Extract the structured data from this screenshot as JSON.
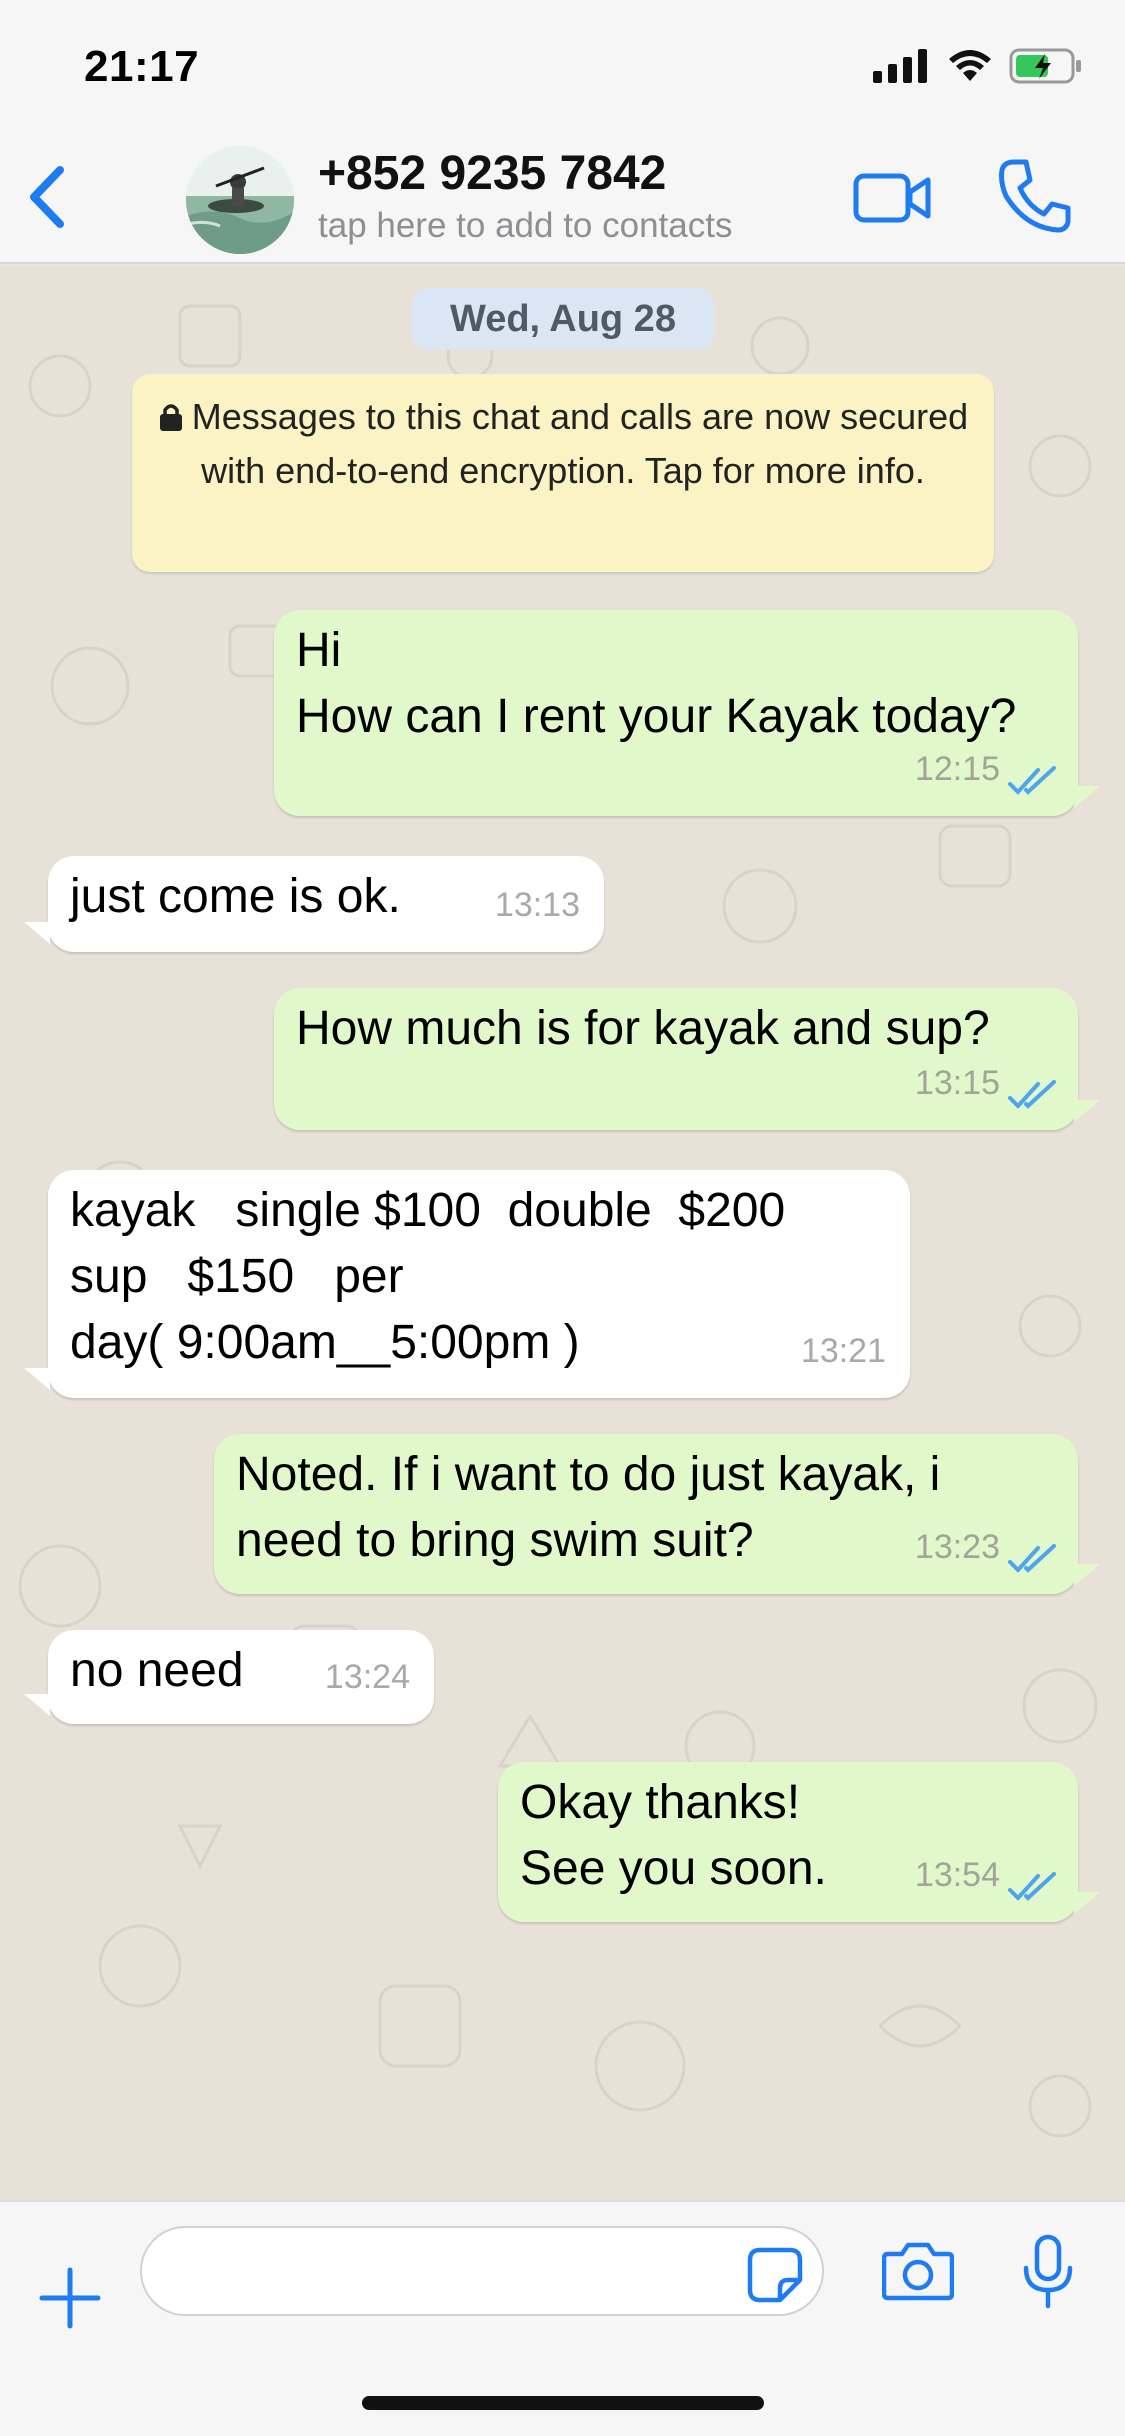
{
  "status_bar": {
    "time": "21:17"
  },
  "header": {
    "contact_name": "+852 9235 7842",
    "contact_subtitle": "tap here to add to contacts"
  },
  "chat": {
    "date_label": "Wed, Aug 28",
    "encryption_notice": "Messages to this chat and calls are now secured with end-to-end encryption. Tap for more info.",
    "messages": [
      {
        "direction": "outgoing",
        "lines": [
          "Hi",
          "How can I rent your Kayak today?"
        ],
        "time": "12:15",
        "status": "read"
      },
      {
        "direction": "incoming",
        "lines": [
          "just come is ok."
        ],
        "time": "13:13"
      },
      {
        "direction": "outgoing",
        "lines": [
          "How much is for kayak and sup?"
        ],
        "time": "13:15",
        "status": "read"
      },
      {
        "direction": "incoming",
        "lines": [
          "kayak   single $100  double  $200",
          "sup   $150   per",
          "day( 9:00am__5:00pm )"
        ],
        "time": "13:21"
      },
      {
        "direction": "outgoing",
        "lines": [
          "Noted. If i want to do just kayak, i",
          "need to bring swim suit?"
        ],
        "time": "13:23",
        "status": "read"
      },
      {
        "direction": "incoming",
        "lines": [
          "no need"
        ],
        "time": "13:24"
      },
      {
        "direction": "outgoing",
        "lines": [
          "Okay thanks!",
          "See you soon."
        ],
        "time": "13:54",
        "status": "read"
      }
    ]
  },
  "input_bar": {
    "placeholder": ""
  },
  "icons": {
    "back": "chevron-left-icon",
    "video": "video-camera-icon",
    "call": "phone-icon",
    "plus": "plus-icon",
    "sticker": "sticker-icon",
    "camera": "camera-icon",
    "mic": "microphone-icon",
    "lock": "lock-icon",
    "read_ticks": "double-check-icon"
  },
  "colors": {
    "accent": "#1f7bf2",
    "outgoing_bubble": "#e1f8cb",
    "incoming_bubble": "#ffffff",
    "encryption_banner": "#fbf3c4",
    "date_pill": "#dbe6f4",
    "read_tick": "#4fa3f0"
  }
}
